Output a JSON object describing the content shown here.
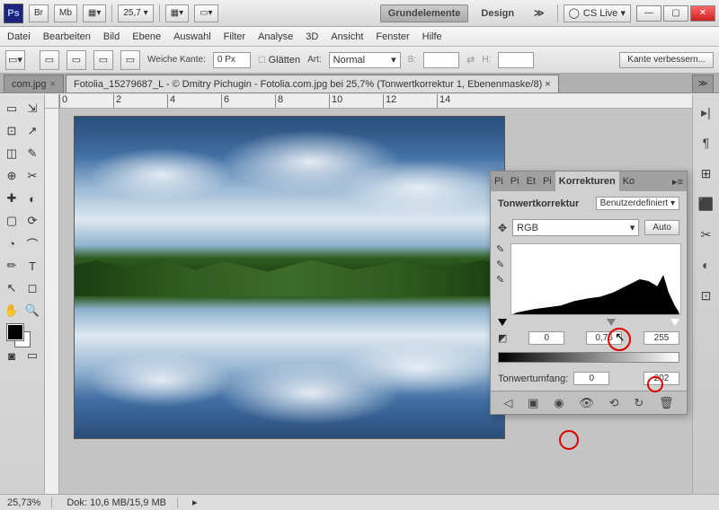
{
  "titlebar": {
    "ps": "Ps",
    "br": "Br",
    "mb": "Mb",
    "zoom": "25,7 ▾",
    "ws_active": "Grundelemente",
    "ws_design": "Design",
    "more": "≫",
    "cslive": "CS Live ▾"
  },
  "menu": [
    "Datei",
    "Bearbeiten",
    "Bild",
    "Ebene",
    "Auswahl",
    "Filter",
    "Analyse",
    "3D",
    "Ansicht",
    "Fenster",
    "Hilfe"
  ],
  "optbar": {
    "weiche": "Weiche Kante:",
    "weiche_val": "0 Px",
    "glatten": "Glätten",
    "art": "Art:",
    "art_val": "Normal",
    "b": "B:",
    "h": "H:",
    "refine": "Kante verbessern..."
  },
  "tabs": {
    "t1": "com.jpg",
    "t2": "Fotolia_15279687_L - © Dmitry Pichugin - Fotolia.com.jpg bei 25,7% (Tonwertkorrektur 1, Ebenenmaske/8) ×",
    "more": "≫"
  },
  "ruler": [
    "0",
    "2",
    "4",
    "6",
    "8",
    "10",
    "12",
    "14"
  ],
  "adj": {
    "tabs": {
      "t1": "Pi",
      "t2": "Pi",
      "t3": "Et",
      "t4": "Pi",
      "active": "Korrekturen",
      "t6": "Ko"
    },
    "title": "Tonwertkorrektur",
    "preset": "Benutzerdefiniert ▾",
    "channel": "RGB",
    "auto": "Auto",
    "in_black": "0",
    "in_mid": "0,76",
    "in_white": "255",
    "out_label": "Tonwertumfang:",
    "out_black": "0",
    "out_white": "202"
  },
  "status": {
    "zoom": "25,73%",
    "dok": "Dok: 10,6 MB/15,9 MB"
  },
  "tools": [
    "▭",
    "⇲",
    "⊡",
    "↗",
    "◫",
    "✎",
    "⊕",
    "✂",
    "✚",
    "◐",
    "▢",
    "⟳",
    "◔",
    "⌒",
    "✏",
    "⌫",
    "⬒",
    "●",
    "◉",
    "▭",
    "✒",
    "T",
    "↖",
    "◻",
    "✋",
    "🔍"
  ],
  "ricons": [
    "▸|",
    "¶",
    "⊞",
    "⬛",
    "✂",
    "◐",
    "⊡"
  ]
}
